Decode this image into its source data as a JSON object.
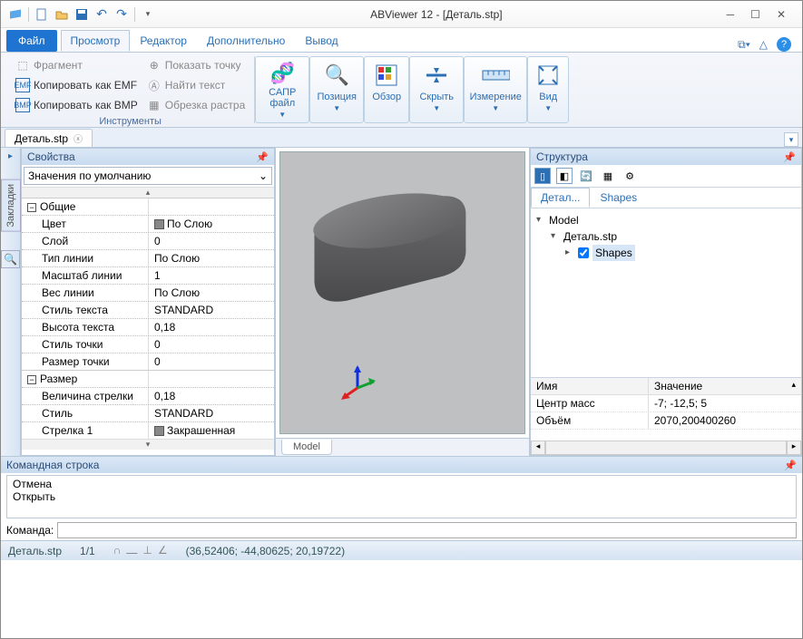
{
  "title": "ABViewer 12 - [Деталь.stp]",
  "tabs": {
    "file": "Файл",
    "view": "Просмотр",
    "editor": "Редактор",
    "extra": "Дополнительно",
    "output": "Вывод"
  },
  "ribbon": {
    "group_tools_caption": "Инструменты",
    "fragment": "Фрагмент",
    "copy_emf": "Копировать как EMF",
    "copy_bmp": "Копировать как BMP",
    "show_point": "Показать точку",
    "find_text": "Найти текст",
    "crop_raster": "Обрезка растра",
    "cad_file": "САПР файл",
    "position": "Позиция",
    "overview": "Обзор",
    "hide": "Скрыть",
    "measure": "Измерение",
    "view_btn": "Вид"
  },
  "doc_tab": "Деталь.stp",
  "side_rail": {
    "bookmarks": "Закладки"
  },
  "props": {
    "title": "Свойства",
    "defaults": "Значения по умолчанию",
    "cat_general": "Общие",
    "rows_general": [
      {
        "k": "Цвет",
        "v": "По Слою",
        "color": true
      },
      {
        "k": "Слой",
        "v": "0"
      },
      {
        "k": "Тип линии",
        "v": "По Слою"
      },
      {
        "k": "Масштаб линии",
        "v": "1"
      },
      {
        "k": "Вес линии",
        "v": "По Слою"
      },
      {
        "k": "Стиль текста",
        "v": "STANDARD"
      },
      {
        "k": "Высота текста",
        "v": "0,18"
      },
      {
        "k": "Стиль точки",
        "v": "0"
      },
      {
        "k": "Размер точки",
        "v": "0"
      }
    ],
    "cat_size": "Размер",
    "rows_size": [
      {
        "k": "Величина стрелки",
        "v": "0,18"
      },
      {
        "k": "Стиль",
        "v": "STANDARD"
      },
      {
        "k": "Стрелка 1",
        "v": "Закрашенная",
        "color": true
      }
    ]
  },
  "viewport_tab": "Model",
  "structure": {
    "title": "Структура",
    "tab1": "Детал...",
    "tab2": "Shapes",
    "tree": {
      "root": "Model",
      "file": "Деталь.stp",
      "shapes": "Shapes"
    },
    "details_head": {
      "name": "Имя",
      "value": "Значение"
    },
    "details": [
      {
        "k": "Центр масс",
        "v": "-7; -12,5; 5"
      },
      {
        "k": "Объём",
        "v": "2070,200400260"
      }
    ]
  },
  "cmd": {
    "title": "Командная строка",
    "log": [
      "Отмена",
      "Открыть"
    ],
    "prompt": "Команда:"
  },
  "status": {
    "file": "Деталь.stp",
    "page": "1/1",
    "coords": "(36,52406; -44,80625; 20,19722)"
  }
}
